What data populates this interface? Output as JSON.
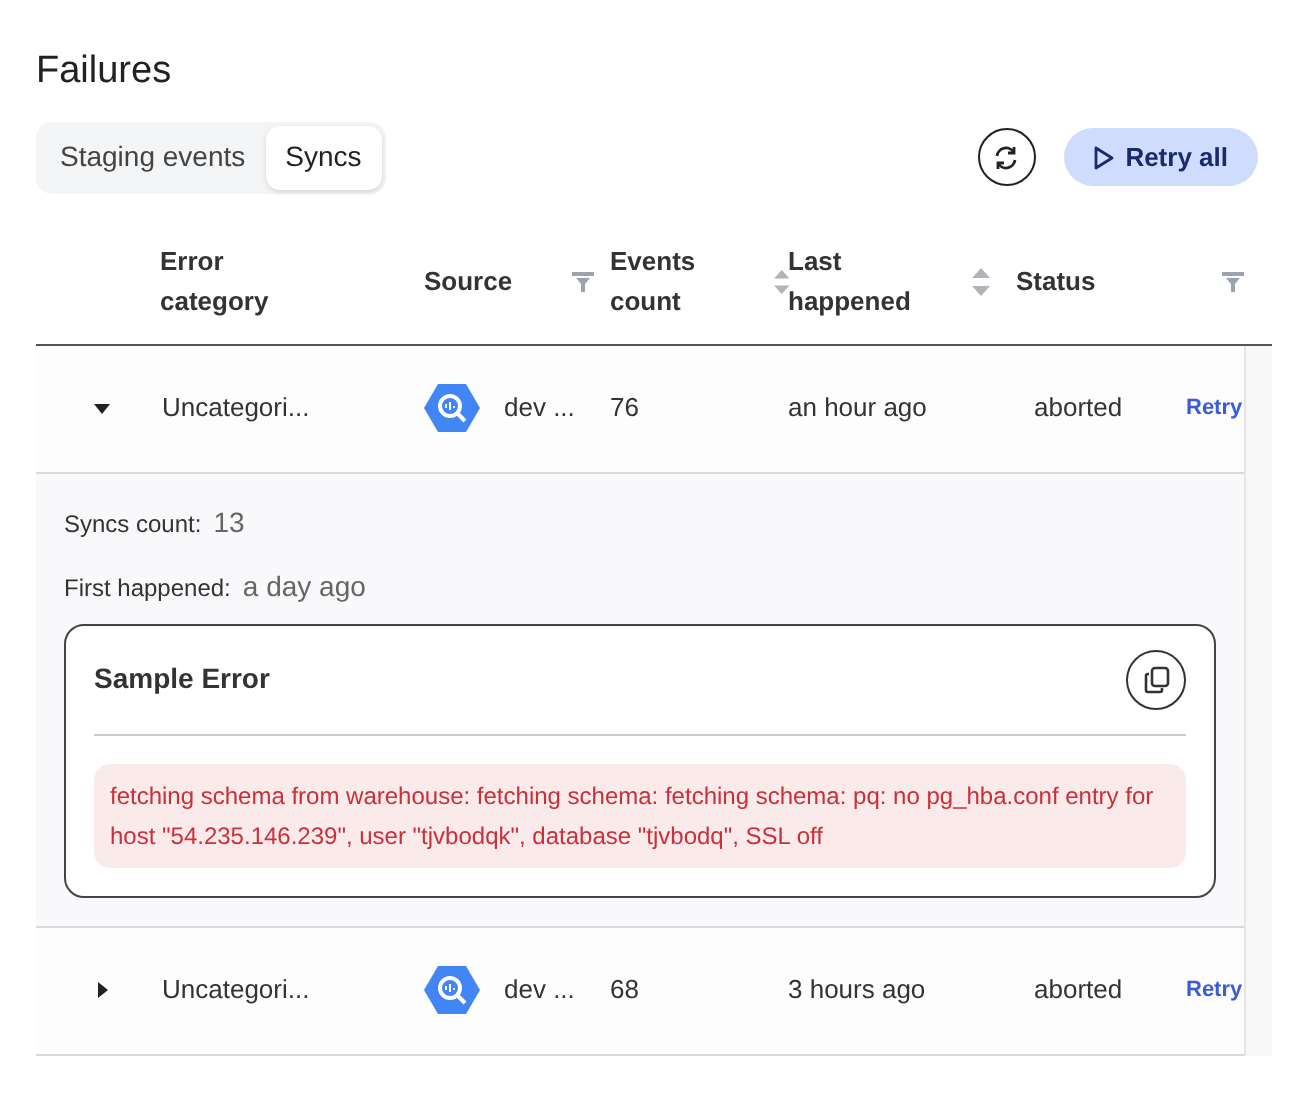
{
  "title": "Failures",
  "tabs": [
    {
      "label": "Staging events",
      "selected": false
    },
    {
      "label": "Syncs",
      "selected": true
    }
  ],
  "actions": {
    "retry_all": "Retry all"
  },
  "table": {
    "columns": [
      {
        "label": "Error category",
        "kind": "plain"
      },
      {
        "label": "Source",
        "kind": "filter"
      },
      {
        "label": "Events count",
        "kind": "sort"
      },
      {
        "label": "Last happened",
        "kind": "sort"
      },
      {
        "label": "Status",
        "kind": "filter"
      }
    ],
    "rows": [
      {
        "expanded": true,
        "category": "Uncategori...",
        "source": "dev ...",
        "events_count": "76",
        "last_happened": "an hour ago",
        "status": "aborted",
        "action": "Retry",
        "details": {
          "syncs_count_label": "Syncs count:",
          "syncs_count": "13",
          "first_happened_label": "First happened:",
          "first_happened": "a day ago",
          "sample_title": "Sample Error",
          "sample_error": "fetching schema from warehouse: fetching schema: fetching schema: pq: no pg_hba.conf entry for host \"54.235.146.239\", user \"tjvbodqk\", database \"tjvbodq\", SSL off"
        }
      },
      {
        "expanded": false,
        "category": "Uncategori...",
        "source": "dev ...",
        "events_count": "68",
        "last_happened": "3 hours ago",
        "status": "aborted",
        "action": "Retry"
      }
    ]
  }
}
